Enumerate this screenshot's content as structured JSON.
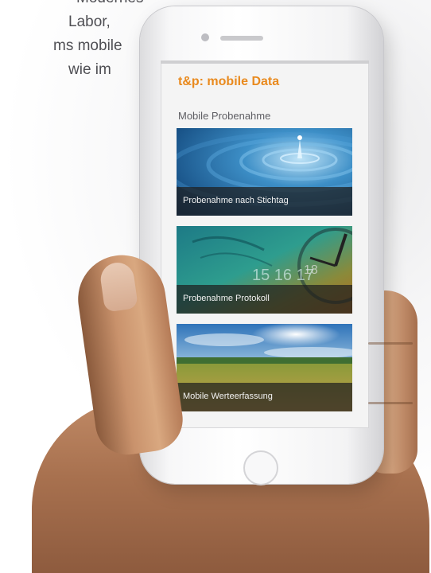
{
  "marketing_text": {
    "line1": "Modernes",
    "line2": "Labor,",
    "line3": "ms mobile",
    "line4": "wie im"
  },
  "app": {
    "title": "t&p: mobile Data",
    "section_title": "Mobile Probenahme",
    "accent_color": "#e98a1e",
    "cards": [
      {
        "label": "Probenahme nach Stichtag",
        "image": "water-drop-ripples"
      },
      {
        "label": "Probenahme Protokoll",
        "image": "calendar-clock-collage"
      },
      {
        "label": "Mobile Werteerfassung",
        "image": "wheat-field-sky"
      }
    ]
  }
}
